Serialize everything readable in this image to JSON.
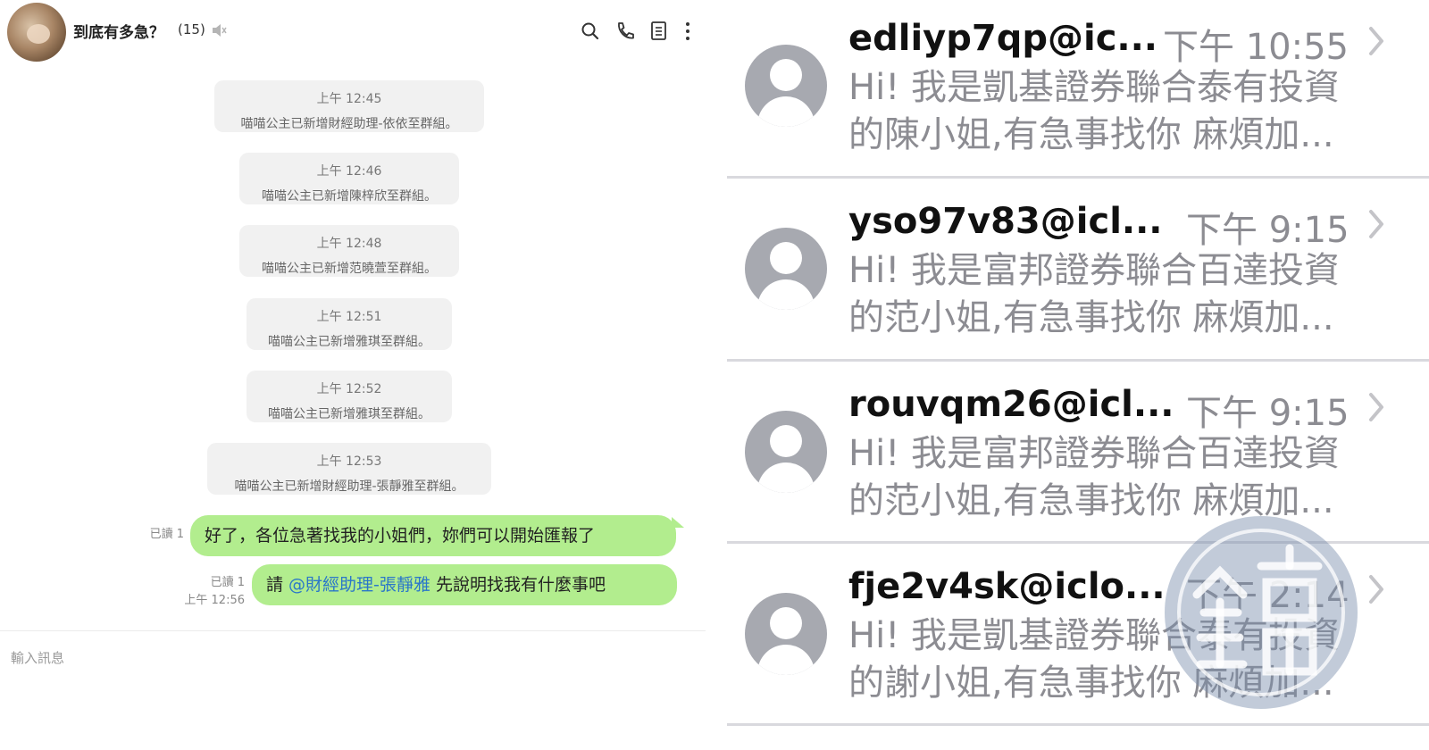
{
  "chat": {
    "title": "到底有多急？",
    "member_count": "(15)",
    "system_messages": [
      {
        "time": "上午 12:45",
        "text": "喵喵公主已新增財經助理-依依至群組。"
      },
      {
        "time": "上午 12:46",
        "text": "喵喵公主已新增陳梓欣至群組。"
      },
      {
        "time": "上午 12:48",
        "text": "喵喵公主已新增范曉萱至群組。"
      },
      {
        "time": "上午 12:51",
        "text": "喵喵公主已新增雅琪至群組。"
      },
      {
        "time": "上午 12:52",
        "text": "喵喵公主已新增雅琪至群組。"
      },
      {
        "time": "上午 12:53",
        "text": "喵喵公主已新增財經助理-張靜雅至群組。"
      }
    ],
    "messages": [
      {
        "read": "已讀 1",
        "time": "",
        "text": "好了，各位急著找我的小姐們，妳們可以開始匯報了"
      },
      {
        "read": "已讀 1",
        "time": "上午 12:56",
        "prefix": "請 ",
        "mention": "@財經助理-張靜雅",
        "suffix": " 先說明找我有什麼事吧"
      }
    ],
    "input_placeholder": "輸入訊息",
    "icons": [
      "search-icon",
      "phone-icon",
      "notes-icon",
      "more-icon",
      "mute-icon"
    ]
  },
  "inbox": {
    "items": [
      {
        "sender": "edliyp7qp@ic...",
        "time": "下午 10:55",
        "line1": "Hi! 我是凱基證券聯合泰有投資",
        "line2": "的陳小姐,有急事找你 麻煩加..."
      },
      {
        "sender": "yso97v83@icl...",
        "time": "下午 9:15",
        "line1": "Hi! 我是富邦證券聯合百達投資",
        "line2": "的范小姐,有急事找你 麻煩加..."
      },
      {
        "sender": "rouvqm26@icl...",
        "time": "下午 9:15",
        "line1": "Hi! 我是富邦證券聯合百達投資",
        "line2": "的范小姐,有急事找你 麻煩加..."
      },
      {
        "sender": "fje2v4sk@iclo...",
        "time": "下午 2:14",
        "line1": "Hi! 我是凱基證券聯合泰有投資",
        "line2": "的謝小姐,有急事找你 麻煩加..."
      }
    ]
  },
  "watermark": {
    "icon": "mirror-media-logo",
    "text": "鏡週"
  },
  "colors": {
    "bubble": "#b2ed8e",
    "mention": "#2a77c9",
    "system_bg": "#f1f1f1",
    "avatar_gray": "#a7a9b0",
    "time_gray": "#8c8c92"
  }
}
